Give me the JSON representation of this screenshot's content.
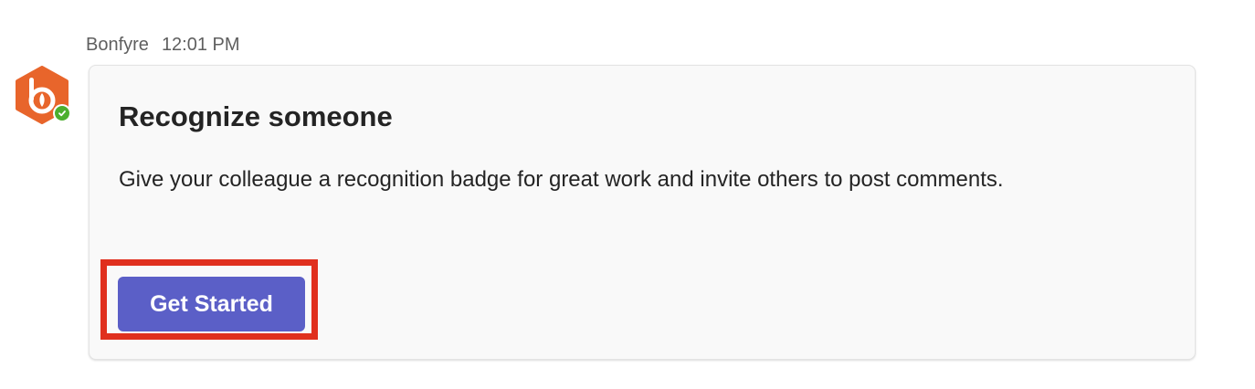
{
  "message": {
    "sender": "Bonfyre",
    "time": "12:01 PM",
    "avatar": {
      "icon": "bonfyre-logo-icon",
      "brand_color": "#e8652b",
      "presence": "available",
      "presence_color": "#4caf2f"
    }
  },
  "card": {
    "title": "Recognize someone",
    "body": "Give your colleague a recognition badge for great work and invite others to post comments.",
    "action": {
      "label": "Get Started",
      "color": "#5b5fc7",
      "highlight_color": "#e0301e"
    }
  }
}
